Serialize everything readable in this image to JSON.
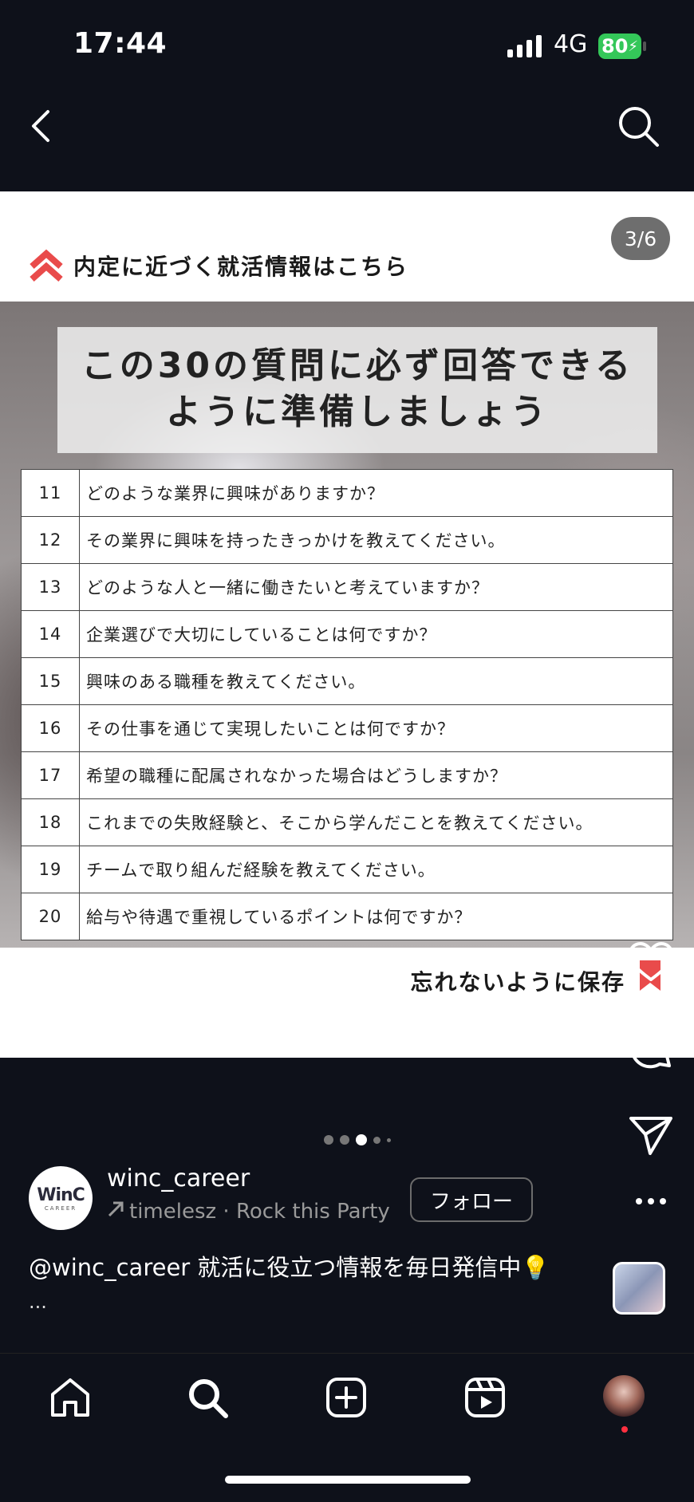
{
  "status_bar": {
    "time": "17:44",
    "network": "4G",
    "battery": "80"
  },
  "post": {
    "page_counter": "3/6",
    "banner": "内定に近づく就活情報はこちら",
    "headline_line1": "この30の質問に必ず回答できる",
    "headline_line2": "ように準備しましょう",
    "questions": [
      {
        "num": "11",
        "text": "どのような業界に興味がありますか？"
      },
      {
        "num": "12",
        "text": "その業界に興味を持ったきっかけを教えてください。"
      },
      {
        "num": "13",
        "text": "どのような人と一緒に働きたいと考えていますか？"
      },
      {
        "num": "14",
        "text": "企業選びで大切にしていることは何ですか？"
      },
      {
        "num": "15",
        "text": "興味のある職種を教えてください。"
      },
      {
        "num": "16",
        "text": "その仕事を通じて実現したいことは何ですか？"
      },
      {
        "num": "17",
        "text": "希望の職種に配属されなかった場合はどうしますか？"
      },
      {
        "num": "18",
        "text": "これまでの失敗経験と、そこから学んだことを教えてください。"
      },
      {
        "num": "19",
        "text": "チームで取り組んだ経験を教えてください。"
      },
      {
        "num": "20",
        "text": "給与や待遇で重視しているポイントは何ですか？"
      }
    ],
    "save_text": "忘れないように保存"
  },
  "author": {
    "avatar_logo": "WinC",
    "avatar_sub": "CAREER",
    "username": "winc_career",
    "music": "timelesz · Rock this Party",
    "follow_label": "フォロー"
  },
  "caption": {
    "text": "@winc_career 就活に役立つ情報を毎日発信中💡",
    "more": "..."
  },
  "carousel": {
    "current_index": 3,
    "total_dots": 5
  },
  "colors": {
    "background": "#0e111a",
    "accent_red": "#e94b4b",
    "battery_green": "#34c759"
  },
  "icons": [
    "back-icon",
    "search-icon",
    "heart-icon",
    "comment-icon",
    "send-icon",
    "more-icon",
    "home-icon",
    "create-icon",
    "reels-icon"
  ]
}
